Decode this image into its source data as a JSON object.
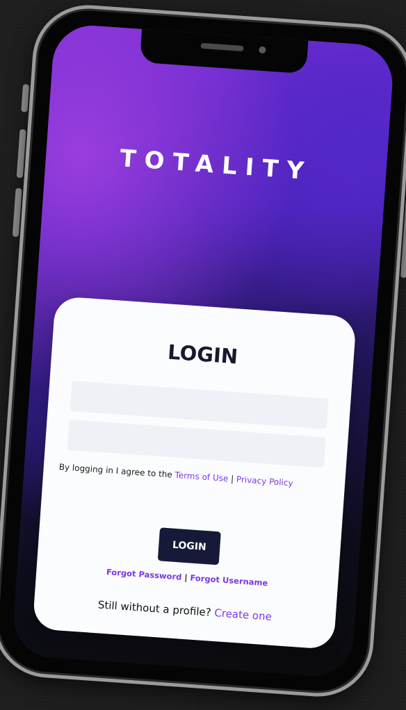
{
  "app": {
    "brand": "TOTALITY"
  },
  "login": {
    "title": "LOGIN",
    "username": {
      "value": "",
      "placeholder": ""
    },
    "password": {
      "value": "",
      "placeholder": ""
    },
    "terms_prefix": "By logging in I agree to the ",
    "terms_link": "Terms of Use",
    "terms_separator": " | ",
    "privacy_link": "Privacy Policy",
    "submit_label": "LOGIN",
    "forgot_password": "Forgot Password",
    "forgot_separator": " | ",
    "forgot_username": "Forgot Username",
    "signup_prompt": "Still without a profile? ",
    "signup_link": "Create one"
  },
  "colors": {
    "accent": "#7a38e8",
    "button": "#161a38",
    "card": "#fbfcfd",
    "field": "#eef1f6",
    "background": "#1c1c1d"
  }
}
